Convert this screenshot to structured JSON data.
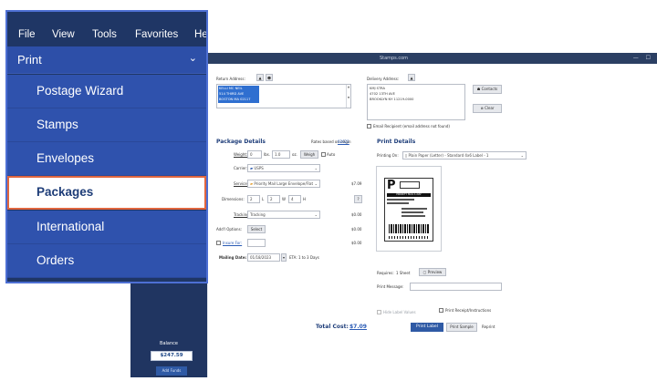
{
  "menu": {
    "menubar": [
      "File",
      "View",
      "Tools",
      "Favorites",
      "He"
    ],
    "print_label": "Print",
    "items": [
      "Postage Wizard",
      "Stamps",
      "Envelopes",
      "Packages",
      "International",
      "Orders"
    ],
    "active_item": "Packages"
  },
  "window": {
    "title": "Stamps.com",
    "controls": "— ☐",
    "edge_fragment": "e"
  },
  "sidebar": {
    "balance_label": "Balance",
    "balance_value": "$247.59",
    "add_funds_label": "Add Funds"
  },
  "return_address": {
    "label": "Return Address:",
    "lines": [
      "KELLI MC NEIL",
      "514 THIRD AVE",
      "BOSTON MA 02117"
    ]
  },
  "delivery_address": {
    "label": "Delivery Address:",
    "lines": [
      "KMJ STRA",
      "4702 13TH AVE",
      "BROOKLYN NY 11219-0000"
    ],
    "contacts_label": "Contacts",
    "clear_label": "Clear",
    "email_recipient_label": "Email Recipient (email address not found)"
  },
  "package_details": {
    "heading": "Package Details",
    "rates_text": "Rates based on origin",
    "rates_zip": "02021",
    "weight_label": "Weight:",
    "weight_lbs": "0",
    "weight_lbs_unit": "lbs.",
    "weight_oz": "1.0",
    "weight_oz_unit": "oz.",
    "weigh_button": "Weigh",
    "auto_label": "Auto",
    "carrier_label": "Carrier:",
    "carrier_value": "USPS",
    "service_label": "Service:",
    "service_value": "Priority Mail Large Envelope/Flat",
    "service_price": "$7.09",
    "dimensions_label": "Dimensions:",
    "dim_l": "2",
    "dim_w": "2",
    "dim_h": "4",
    "dim_l_unit": "L",
    "dim_w_unit": "W",
    "dim_h_unit": "H",
    "tracking_label": "Tracking:",
    "tracking_value": "Tracking",
    "tracking_price": "$0.00",
    "addons_label": "Add'l Options:",
    "addons_button": "Select",
    "addons_price": "$0.00",
    "insure_label": "Insure For:",
    "insure_price": "$0.00",
    "mailing_date_label": "Mailing Date:",
    "mailing_date_value": "01/18/2023",
    "eta_text": "ETA: 1 to 3 Days",
    "total_label": "Total Cost:",
    "total_value": "$7.09"
  },
  "print_details": {
    "heading": "Print Details",
    "printing_on_label": "Printing On:",
    "printing_on_value": "Plain Paper (Letter) - Standard 4x6 Label - 1",
    "requires_label": "Requires:",
    "requires_value": "1 Sheet",
    "preview_button": "Preview",
    "print_message_label": "Print Message:",
    "hide_label_values": "Hide Label Values",
    "print_receipt": "Print Receipt/Instructions",
    "print_label_button": "Print Label",
    "print_sample_button": "Print Sample",
    "reprint_button": "Reprint"
  },
  "label_preview": {
    "big_letter": "P",
    "service_banner": "PRIORITY MAIL 1-DAY"
  },
  "colors": {
    "menu_bg": "#1f3665",
    "menu_item_bg": "#2f52ad",
    "active_border": "#e0663f",
    "accent": "#1f3e7a"
  }
}
